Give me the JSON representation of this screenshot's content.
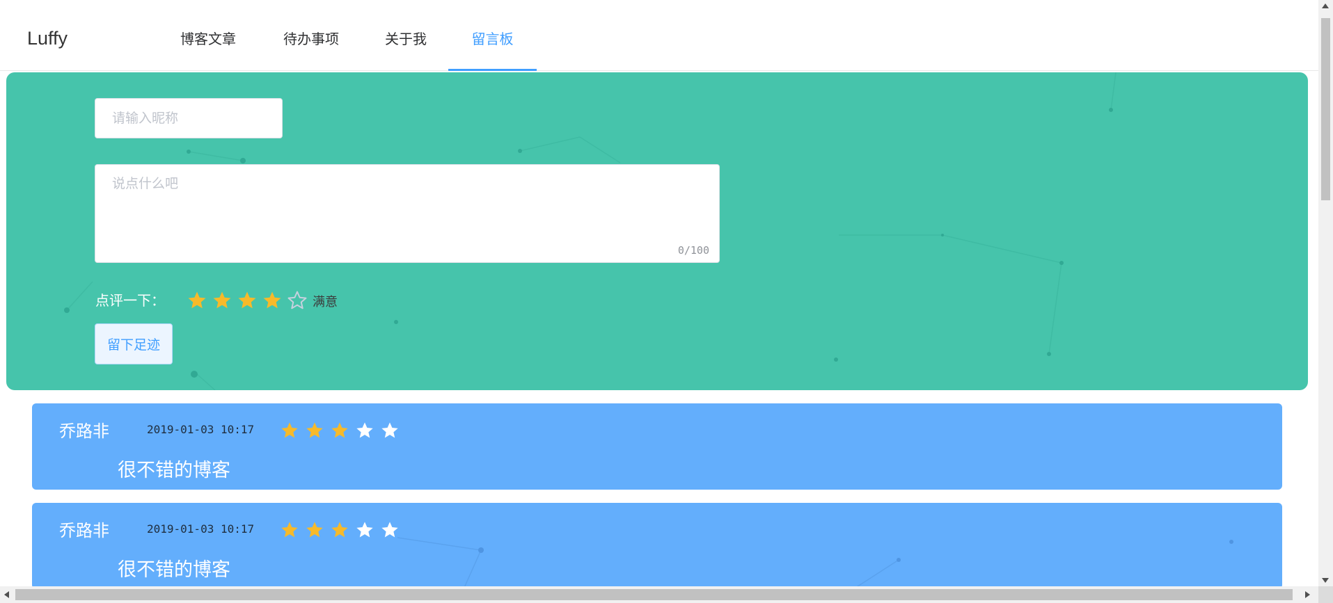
{
  "header": {
    "brand": "Luffy",
    "nav": [
      {
        "label": "博客文章",
        "active": false
      },
      {
        "label": "待办事项",
        "active": false
      },
      {
        "label": "关于我",
        "active": false
      },
      {
        "label": "留言板",
        "active": true
      }
    ]
  },
  "form": {
    "nickname_placeholder": "请输入昵称",
    "nickname_value": "",
    "message_placeholder": "说点什么吧",
    "message_value": "",
    "char_count": "0/100",
    "rate_label": "点评一下：",
    "rating": 4,
    "rating_max": 5,
    "rating_text": "满意",
    "submit_label": "留下足迹"
  },
  "messages": [
    {
      "author": "乔路非",
      "time": "2019-01-03 10:17",
      "rating": 3,
      "content": "很不错的博客"
    },
    {
      "author": "乔路非",
      "time": "2019-01-03 10:17",
      "rating": 3,
      "content": "很不错的博客"
    }
  ],
  "icons": {
    "star": "star-icon",
    "star_outline": "star-outline-icon"
  },
  "colors": {
    "accent": "#409eff",
    "compose_bg": "#46c4ab",
    "card_bg": "#63aefc",
    "star_on": "#f7ba2a",
    "star_off_card": "#ffffff",
    "star_off_form": "#c6d1de"
  }
}
